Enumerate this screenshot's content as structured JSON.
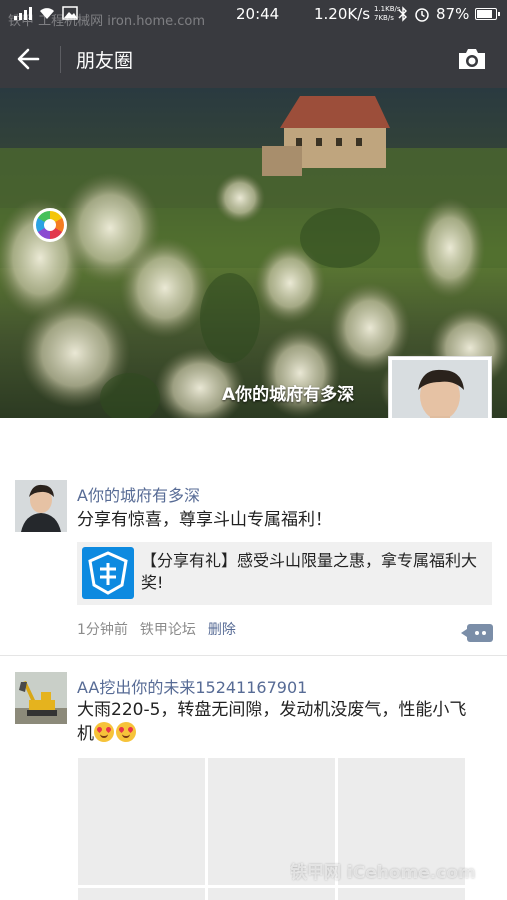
{
  "status_bar": {
    "time": "20:44",
    "speed": "1.20K/s",
    "speed_up": "1.1KB/s",
    "speed_down": "7KB/s",
    "battery": "87%",
    "battery_level": 0.87
  },
  "title_bar": {
    "title": "朋友圈",
    "back_icon": "arrow-left-icon",
    "camera_icon": "camera-icon"
  },
  "cover": {
    "username": "A你的城府有多深"
  },
  "posts": [
    {
      "username": "A你的城府有多深",
      "text": "分享有惊喜，尊享斗山专属福利！",
      "share_card_text": "【分享有礼】感受斗山限量之惠，拿专属福利大奖!",
      "time": "1分钟前",
      "source": "铁甲论坛",
      "delete_label": "删除"
    },
    {
      "username": "AA挖出你的未来15241167901",
      "text": "大雨220-5，转盘无间隙，发动机没废气，性能小飞机"
    }
  ],
  "watermark": {
    "top": "铁甲 工程机械网 iron.home.com",
    "bottom": "铁甲网 iCehome.com"
  },
  "colors": {
    "bar_bg": "#393a3f",
    "link": "#576b95",
    "meta": "#8c8c8c"
  }
}
